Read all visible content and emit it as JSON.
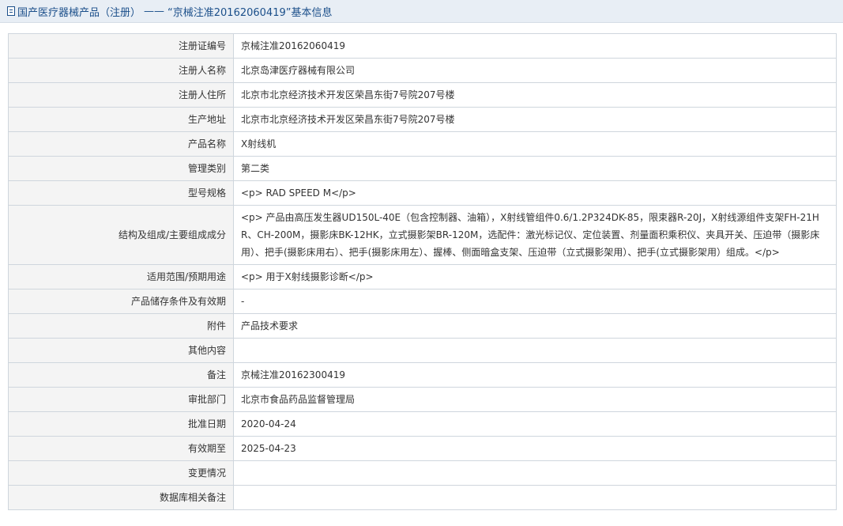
{
  "header": {
    "icon": "document-icon",
    "category": "国产医疗器械产品（注册）",
    "separator": "——",
    "record_title": "“京械注准20162060419”基本信息"
  },
  "rows": [
    {
      "label": "注册证编号",
      "value": "京械注准20162060419"
    },
    {
      "label": "注册人名称",
      "value": "北京岛津医疗器械有限公司"
    },
    {
      "label": "注册人住所",
      "value": "北京市北京经济技术开发区荣昌东街7号院207号楼"
    },
    {
      "label": "生产地址",
      "value": "北京市北京经济技术开发区荣昌东街7号院207号楼"
    },
    {
      "label": "产品名称",
      "value": "X射线机"
    },
    {
      "label": "管理类别",
      "value": "第二类"
    },
    {
      "label": "型号规格",
      "value": "<p> RAD SPEED M</p>"
    },
    {
      "label": "结构及组成/主要组成成分",
      "value": "<p> 产品由高压发生器UD150L-40E（包含控制器、油箱），X射线管组件0.6/1.2P324DK-85，限束器R-20J，X射线源组件支架FH-21HR、CH-200M，摄影床BK-12HK，立式摄影架BR-120M，选配件：激光标记仪、定位装置、剂量面积乘积仪、夹具开关、压迫带（摄影床用）、把手(摄影床用右）、把手(摄影床用左）、握棒、侧面暗盒支架、压迫带（立式摄影架用）、把手(立式摄影架用）组成。</p>"
    },
    {
      "label": "适用范围/预期用途",
      "value": "<p> 用于X射线摄影诊断</p>"
    },
    {
      "label": "产品储存条件及有效期",
      "value": "-"
    },
    {
      "label": "附件",
      "value": "产品技术要求"
    },
    {
      "label": "其他内容",
      "value": ""
    },
    {
      "label": "备注",
      "value": "京械注准20162300419"
    },
    {
      "label": "审批部门",
      "value": "北京市食品药品监督管理局"
    },
    {
      "label": "批准日期",
      "value": "2020-04-24"
    },
    {
      "label": "有效期至",
      "value": "2025-04-23"
    },
    {
      "label": "变更情况",
      "value": ""
    },
    {
      "label": "数据库相关备注",
      "value": ""
    }
  ]
}
